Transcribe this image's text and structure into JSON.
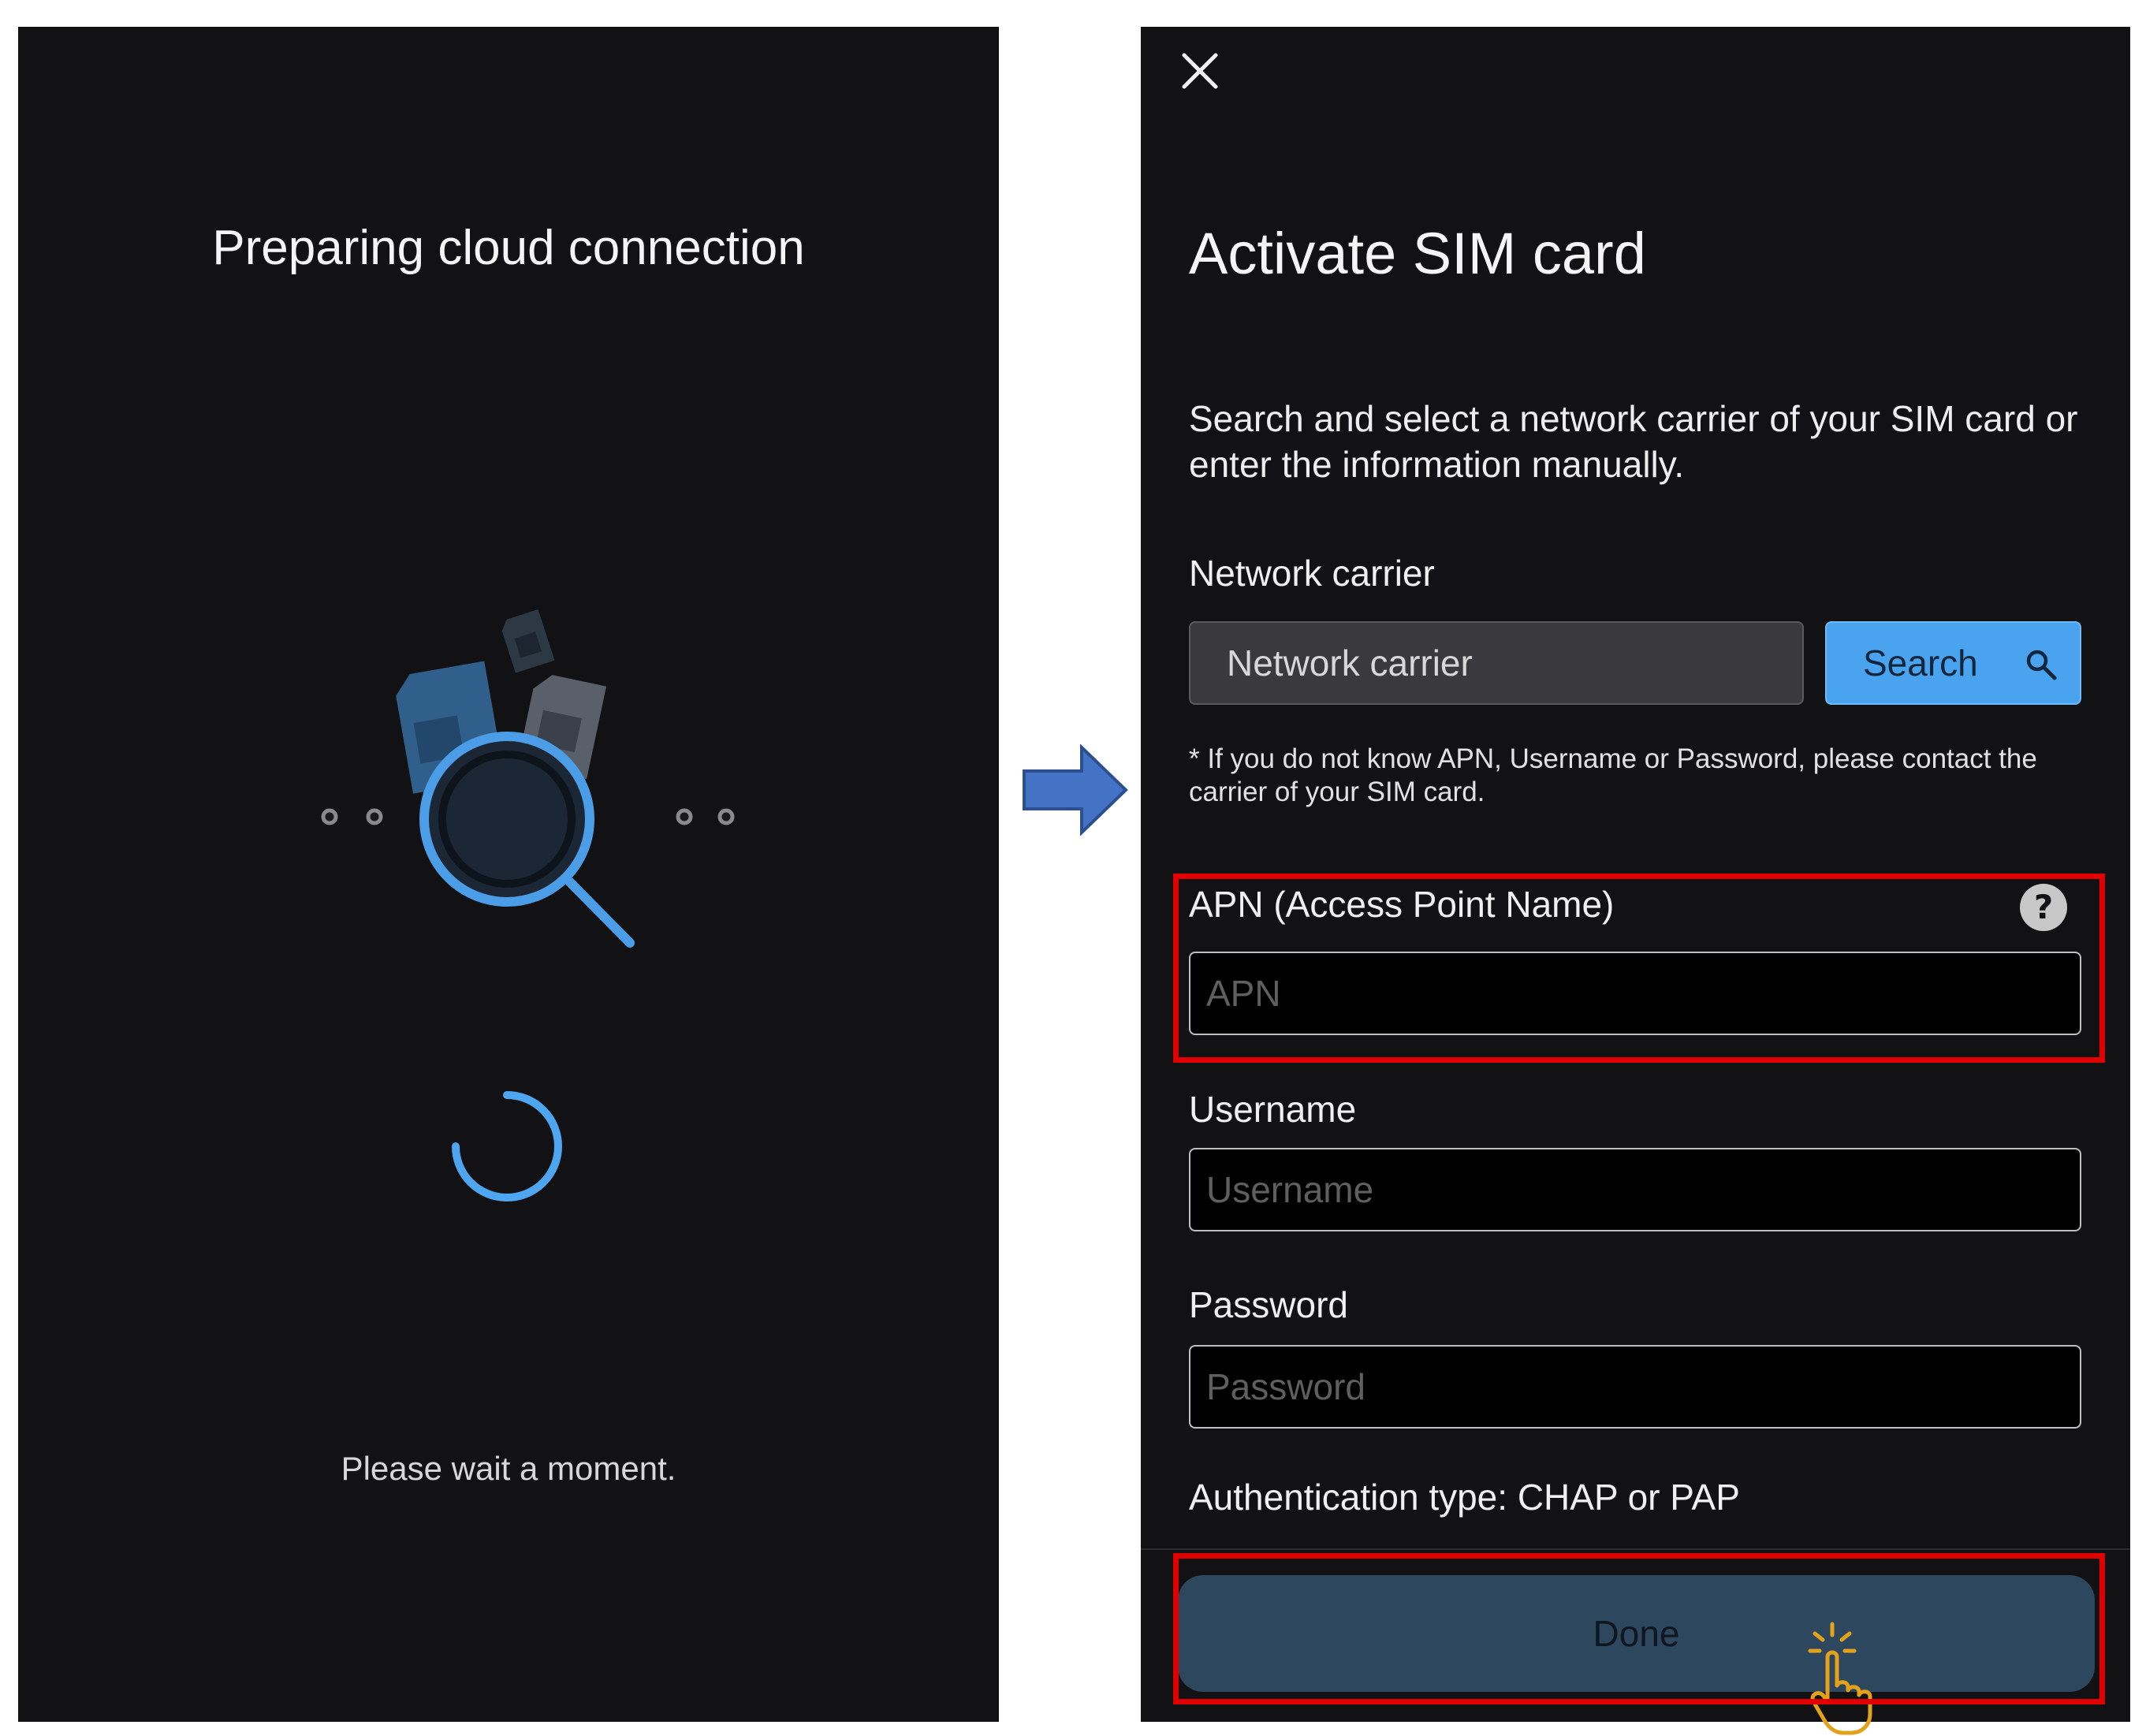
{
  "left_screen": {
    "title": "Preparing cloud connection",
    "wait_text": "Please wait a moment."
  },
  "right_screen": {
    "title": "Activate SIM card",
    "description": "Search and select a network carrier of your SIM card or enter the information manually.",
    "network_carrier": {
      "label": "Network carrier",
      "placeholder": "Network carrier",
      "search_label": "Search"
    },
    "note": "* If you do not know APN, Username or Password, please contact the carrier of your SIM card.",
    "apn": {
      "label": "APN (Access Point Name)",
      "placeholder": "APN"
    },
    "username": {
      "label": "Username",
      "placeholder": "Username"
    },
    "password": {
      "label": "Password",
      "placeholder": "Password"
    },
    "auth_text": "Authentication type: CHAP or PAP",
    "done_label": "Done"
  },
  "icons": {
    "close": "close-icon",
    "search": "search-icon",
    "help": "help-icon",
    "hand": "hand-pointer-icon",
    "arrow": "arrow-right-icon"
  },
  "colors": {
    "screen_bg": "#121214",
    "accent_blue": "#4aa3ee",
    "done_button": "#2c475e",
    "highlight_red": "#e00000"
  }
}
